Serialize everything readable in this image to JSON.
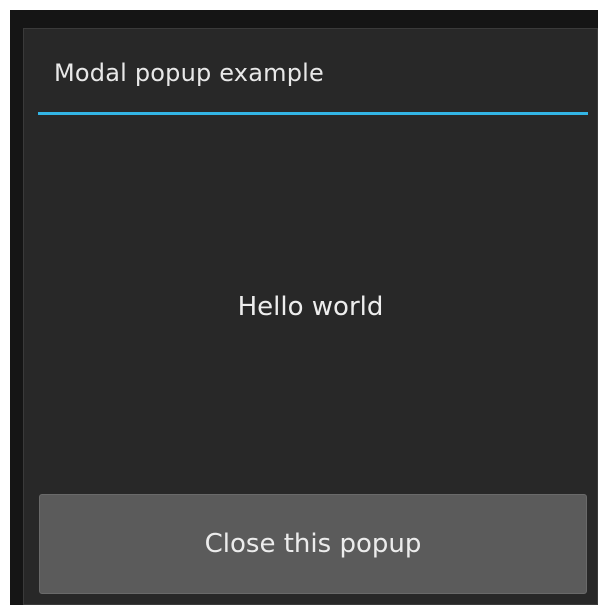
{
  "dialog": {
    "title": "Modal popup example",
    "accent_color": "#33b5e5",
    "background_color": "#282828"
  },
  "body": {
    "message": "Hello world"
  },
  "actions": {
    "close_label": "Close this popup",
    "button_color": "#5b5b5b"
  }
}
